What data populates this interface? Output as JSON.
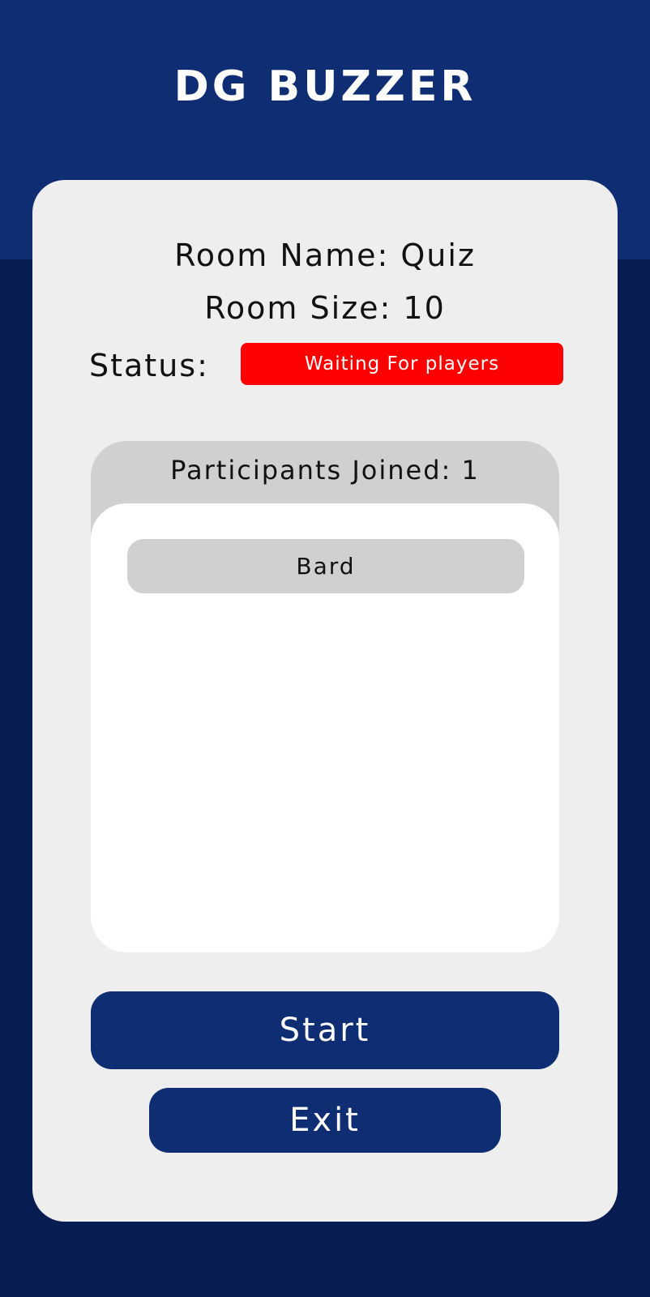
{
  "header": {
    "app_title": "DG BUZZER"
  },
  "room": {
    "name_text": "Room Name: Quiz",
    "size_text": "Room Size: 10",
    "status_label": "Status:",
    "status_value": "Waiting For players"
  },
  "participants": {
    "header": "Participants Joined: 1",
    "items": [
      {
        "name": "Bard"
      }
    ]
  },
  "actions": {
    "start_label": "Start",
    "exit_label": "Exit"
  },
  "colors": {
    "header_blue": "#0e2d73",
    "background_navy": "#071d51",
    "card_gray": "#eeeeef",
    "panel_gray": "#d0d0d1",
    "status_red": "#ff0000"
  }
}
